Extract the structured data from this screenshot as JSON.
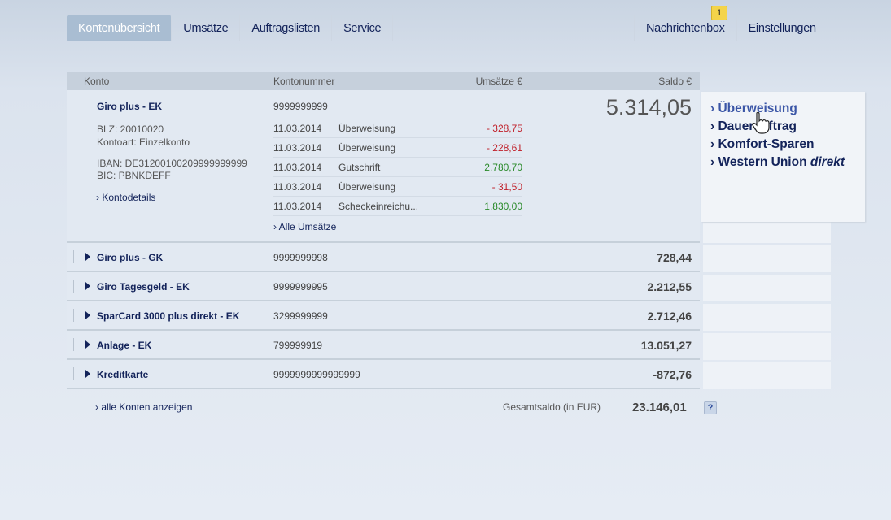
{
  "nav": {
    "left": [
      {
        "label": "Kontenübersicht",
        "active": true
      },
      {
        "label": "Umsätze"
      },
      {
        "label": "Auftragslisten"
      },
      {
        "label": "Service"
      }
    ],
    "right": [
      {
        "label": "Nachrichtenbox"
      },
      {
        "label": "Einstellungen"
      }
    ],
    "message_count": "1"
  },
  "table": {
    "headers": {
      "konto": "Konto",
      "kontonummer": "Kontonummer",
      "umsaetze": "Umsätze €",
      "saldo": "Saldo €"
    },
    "expanded": {
      "name": "Giro plus  - EK",
      "number": "9999999999",
      "saldo": "5.314,05",
      "blz": "BLZ: 20010020",
      "kontoart": "Kontoart: Einzelkonto",
      "iban": "IBAN: DE31200100209999999999",
      "bic": "BIC: PBNKDEFF",
      "details_link": "› Kontodetails",
      "all_link": "› Alle Umsätze",
      "transactions": [
        {
          "date": "11.03.2014",
          "type": "Überweisung",
          "amount": "- 328,75",
          "sign": "neg"
        },
        {
          "date": "11.03.2014",
          "type": "Überweisung",
          "amount": "- 228,61",
          "sign": "neg"
        },
        {
          "date": "11.03.2014",
          "type": "Gutschrift",
          "amount": "2.780,70",
          "sign": "pos"
        },
        {
          "date": "11.03.2014",
          "type": "Überweisung",
          "amount": "- 31,50",
          "sign": "neg"
        },
        {
          "date": "11.03.2014",
          "type": "Scheckeinreichu...",
          "amount": "1.830,00",
          "sign": "pos"
        }
      ]
    },
    "accounts": [
      {
        "name": "Giro plus  - GK",
        "number": "9999999998",
        "saldo": "728,44"
      },
      {
        "name": "Giro Tagesgeld  - EK",
        "number": "9999999995",
        "saldo": "2.212,55"
      },
      {
        "name": "SparCard 3000 plus direkt  - EK",
        "number": "3299999999",
        "saldo": "2.712,46"
      },
      {
        "name": "Anlage  - EK",
        "number": "799999919",
        "saldo": "13.051,27"
      },
      {
        "name": "Kreditkarte",
        "number": "9999999999999999",
        "saldo": "-872,76"
      }
    ]
  },
  "side_menu": [
    {
      "label": "› Überweisung",
      "hover": true
    },
    {
      "label": "› Dauerauftrag"
    },
    {
      "label": "› Komfort-Sparen"
    },
    {
      "label": "› Western Union ",
      "em": "direkt"
    }
  ],
  "footer": {
    "all_accounts": "› alle Konten anzeigen",
    "total_label": "Gesamtsaldo (in EUR)",
    "total": "23.146,01",
    "help": "?"
  },
  "colors": {
    "navy": "#13235a",
    "negative": "#c0202a",
    "positive": "#2a8a2a",
    "active_tab": "#a9bdd2"
  }
}
